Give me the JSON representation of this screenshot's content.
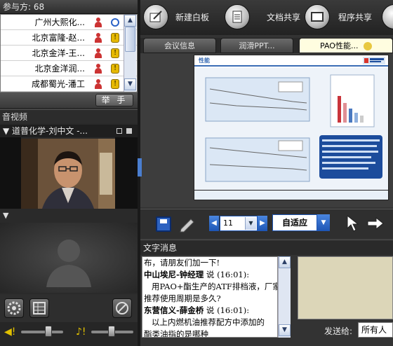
{
  "participants": {
    "header": "参与方: 68",
    "rows": [
      {
        "name": "广州大熙化..."
      },
      {
        "name": "北京富隆-赵..."
      },
      {
        "name": "北京金洋-王..."
      },
      {
        "name": "北京金洋润..."
      },
      {
        "name": "成都蜀光-潘工"
      }
    ],
    "raise_hand_label": "举 手"
  },
  "av": {
    "header": "音视频",
    "video_title": "▼ 道普化学-刘中文 -..."
  },
  "toolbar": {
    "whiteboard_label": "新建白板",
    "doc_share_label": "文档共享",
    "app_share_label": "程序共享"
  },
  "tabs": [
    {
      "label": "会议信息"
    },
    {
      "label": "润滑PPT..."
    },
    {
      "label": "PAO性能..."
    }
  ],
  "slide": {
    "heading": "性能"
  },
  "doc_controls": {
    "page_value": "11",
    "fit_value": "自适应"
  },
  "chat": {
    "header": "文字消息",
    "lines": [
      {
        "text": "布，请朋友们加一下!",
        "bold": false
      },
      {
        "text": "中山埃尼-钟经理",
        "bold": true,
        "suffix": " 说 (16:01):"
      },
      {
        "text": "   用PAO+酯生产的ATF排档液，厂家",
        "bold": false
      },
      {
        "text": "推荐使用周期是多久?",
        "bold": false
      },
      {
        "text": "东营信义-薛金桥",
        "bold": true,
        "suffix": " 说 (16:01):"
      },
      {
        "text": "   以上内燃机油推荐配方中添加的",
        "bold": false
      },
      {
        "text": "酯类油指的是哪种",
        "bold": false
      }
    ],
    "send_to_label": "发送给:",
    "send_to_value": "所有人"
  }
}
